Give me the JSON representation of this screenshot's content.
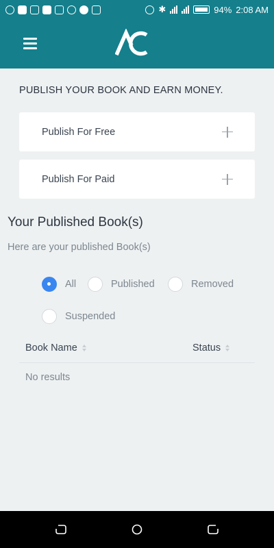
{
  "status_bar": {
    "battery": "94%",
    "time": "2:08 AM",
    "left_icons": [
      "app-icon",
      "mail-icon",
      "lock-icon",
      "shield-icon",
      "image-icon",
      "target-icon",
      "eye-icon",
      "sim-icon"
    ],
    "right_icons": [
      "hotspot-icon",
      "bluetooth-icon",
      "signal-icon",
      "signal-icon",
      "battery-icon"
    ]
  },
  "app_bar": {
    "logo_text": "AC",
    "menu_icon": "hamburger-menu-icon",
    "color": "#157f8c"
  },
  "intro_text": "PUBLISH YOUR BOOK AND EARN MONEY.",
  "publish_options": [
    {
      "label": "Publish For Free",
      "icon": "plus-icon"
    },
    {
      "label": "Publish For Paid",
      "icon": "plus-icon"
    }
  ],
  "published_section": {
    "title": "Your Published Book(s)",
    "subtitle": "Here are your published Book(s)"
  },
  "filters": {
    "options": [
      "All",
      "Published",
      "Removed",
      "Suspended"
    ],
    "selected": "All",
    "accent": "#3a86f0"
  },
  "table": {
    "columns": [
      "Book Name",
      "Status"
    ],
    "empty_text": "No results"
  },
  "nav_bar": {
    "buttons": [
      "back-icon",
      "home-icon",
      "recents-icon"
    ]
  }
}
